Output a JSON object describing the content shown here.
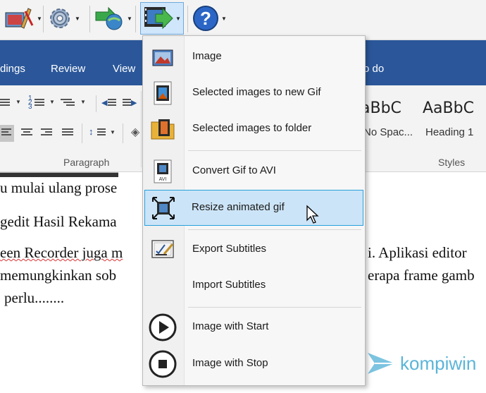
{
  "toolbar": {
    "buttons": [
      "image-editor-icon",
      "settings-icon",
      "export-icon",
      "movie-icon",
      "help-icon"
    ]
  },
  "ribbon": {
    "tabs": [
      "dings",
      "Review",
      "View",
      "o do"
    ],
    "group_labels": {
      "paragraph": "Paragraph",
      "styles": "Styles"
    },
    "styles": [
      {
        "sample": "aBbC",
        "name": "No Spac..."
      },
      {
        "sample": "AaBbC",
        "name": "Heading 1"
      }
    ]
  },
  "document": {
    "lines": [
      "u mulai ulang prose",
      "gedit Hasil Rekama",
      "een Recorder juga m",
      "i. Aplikasi editor",
      "memungkinkan sob",
      "erapa frame gamb",
      "perlu........"
    ]
  },
  "menu": {
    "items": [
      {
        "label": "Image",
        "icon": "image-icon"
      },
      {
        "label": "Selected images to new Gif",
        "icon": "film-strip-icon"
      },
      {
        "label": "Selected images to folder",
        "icon": "folder-icon"
      },
      {
        "label": "Convert Gif to AVI",
        "icon": "avi-file-icon"
      },
      {
        "label": "Resize animated gif",
        "icon": "resize-icon",
        "highlighted": true
      },
      {
        "label": "Export Subtitles",
        "icon": "export-subtitles-icon"
      },
      {
        "label": "Import Subtitles",
        "icon": "import-subtitles-icon"
      },
      {
        "label": "Image with Start",
        "icon": "play-icon"
      },
      {
        "label": "Image with Stop",
        "icon": "stop-icon"
      }
    ]
  },
  "watermark": {
    "text": "kompiwin"
  },
  "colors": {
    "ribbon": "#2b579a",
    "highlight": "#cce4f7",
    "highlight_border": "#26a0da",
    "watermark": "#5bb5d8"
  }
}
